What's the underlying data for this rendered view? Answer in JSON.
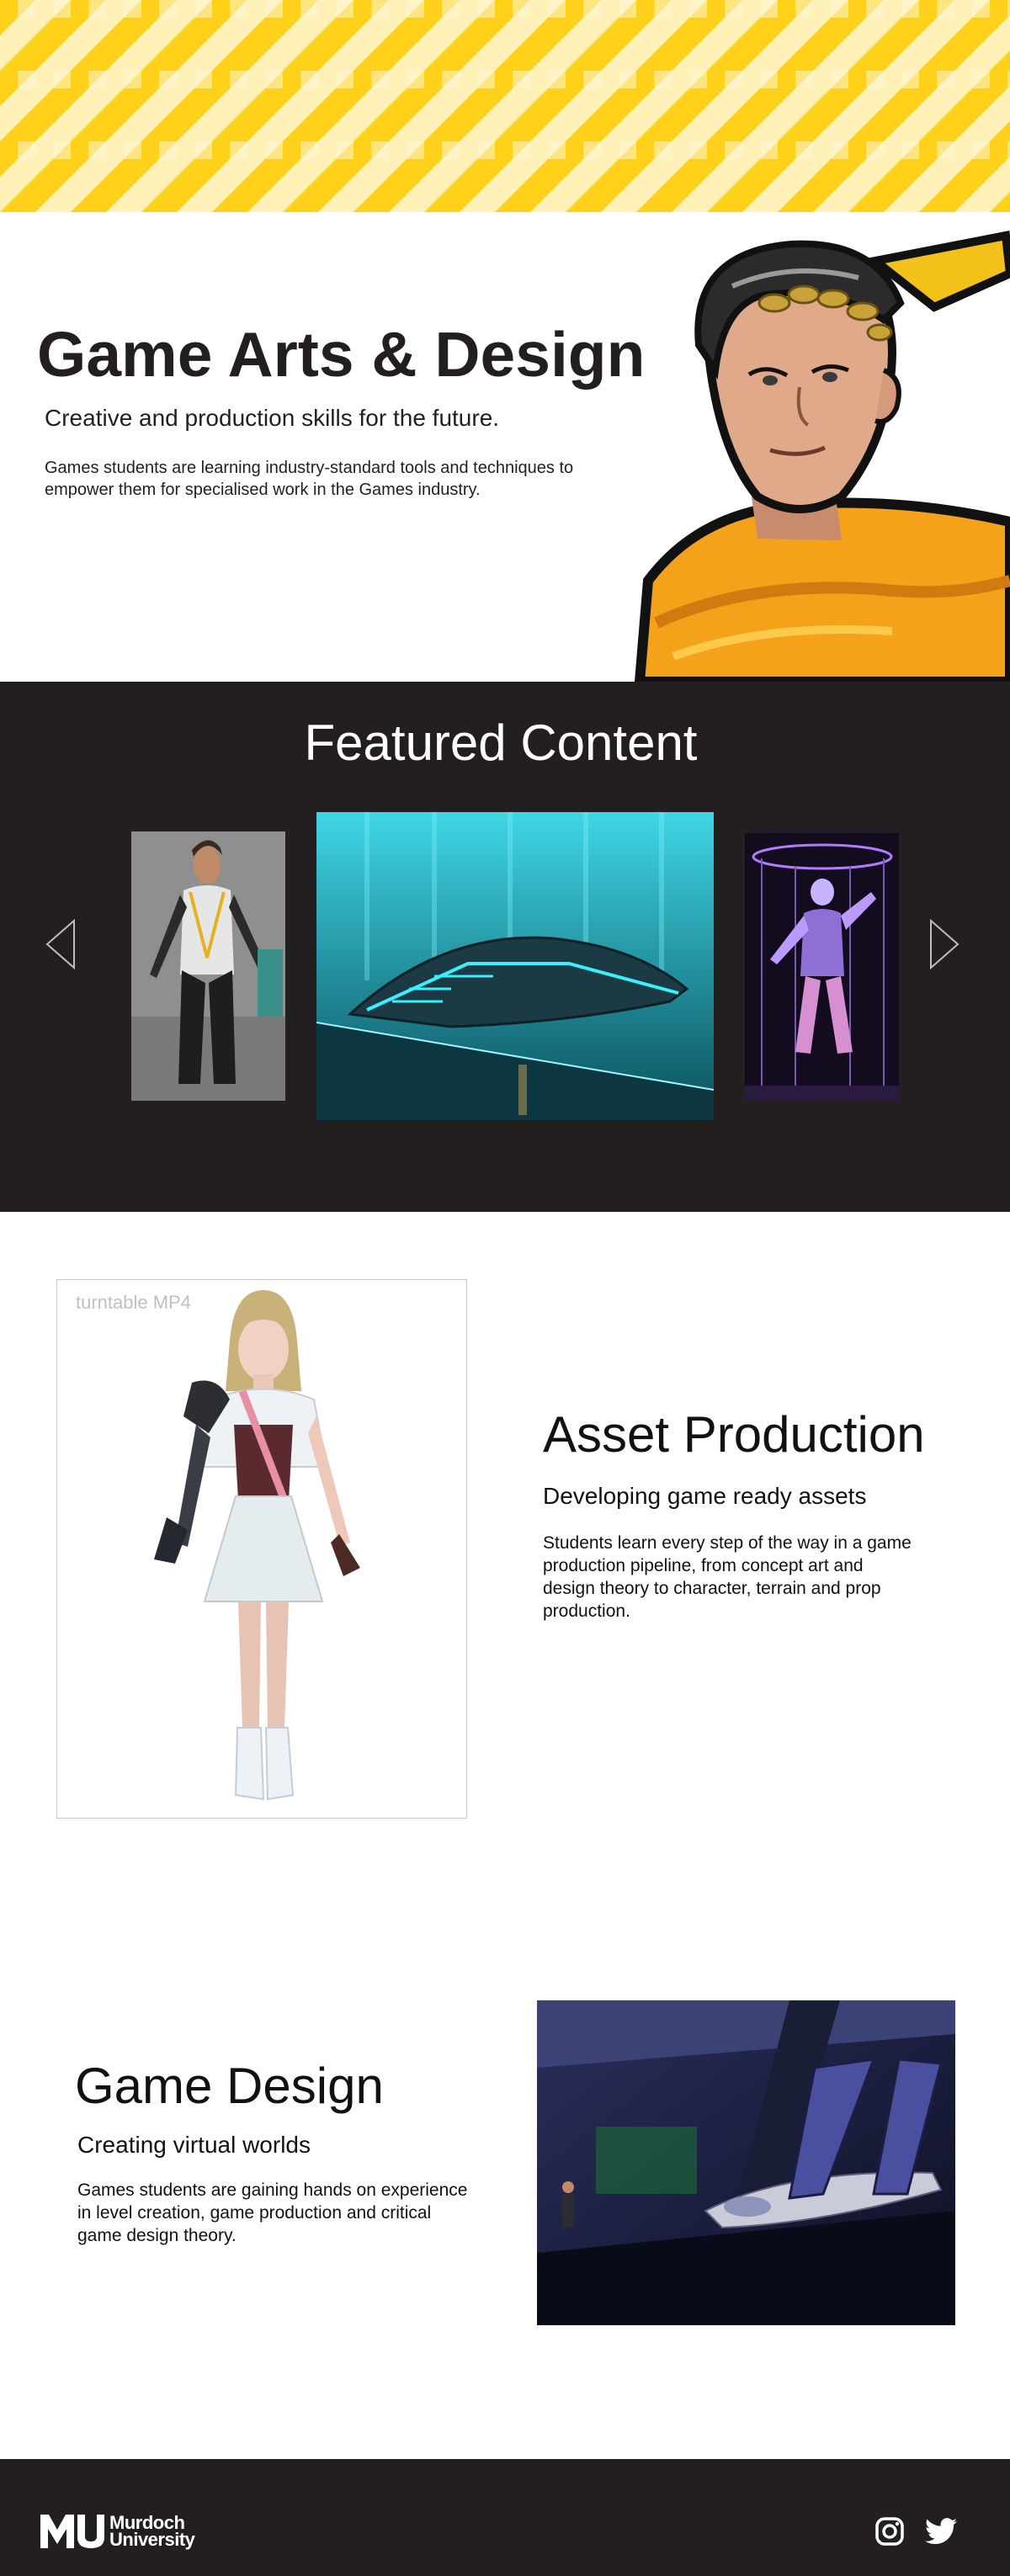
{
  "hero": {
    "title": "Game Arts & Design",
    "subtitle": "Creative and production skills for the future.",
    "body": "Games students are learning industry-standard tools and techniques to empower them for specialised work in the Games industry."
  },
  "featured": {
    "title": "Featured Content"
  },
  "asset_production": {
    "video_label": "turntable MP4",
    "title": "Asset Production",
    "subtitle": "Developing game ready assets",
    "body": "Students learn every step of the way in a game production pipeline, from concept art and design theory to character, terrain and prop production."
  },
  "game_design": {
    "title": "Game Design",
    "subtitle": "Creating virtual worlds",
    "body": "Games students are gaining hands on experience in level creation, game production and critical game design theory."
  },
  "footer": {
    "logo_line1": "Murdoch",
    "logo_line2": "University",
    "social": [
      "instagram-icon",
      "twitter-icon"
    ]
  },
  "colors": {
    "banner_yellow": "#ffd11a",
    "banner_light": "#fff1b8",
    "dark_section": "#231f20",
    "text": "#231f20"
  }
}
